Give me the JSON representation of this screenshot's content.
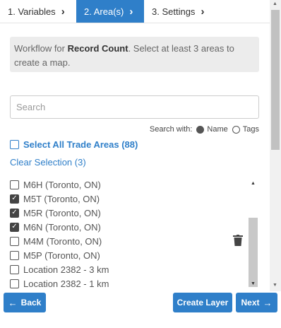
{
  "tabs": [
    {
      "label": "1. Variables"
    },
    {
      "label": "2. Area(s)"
    },
    {
      "label": "3. Settings"
    }
  ],
  "info": {
    "prefix": "Workflow for ",
    "bold": "Record Count",
    "suffix": ". Select at least 3 areas to create a map."
  },
  "search": {
    "placeholder": "Search",
    "search_with_label": "Search with:",
    "options": [
      {
        "label": "Name",
        "selected": true
      },
      {
        "label": "Tags",
        "selected": false
      }
    ]
  },
  "select_all_label": "Select All Trade Areas (88)",
  "clear_selection_label": "Clear Selection (3)",
  "areas": [
    {
      "label": "M6H (Toronto, ON)",
      "checked": false
    },
    {
      "label": "M5T (Toronto, ON)",
      "checked": true
    },
    {
      "label": "M5R (Toronto, ON)",
      "checked": true
    },
    {
      "label": "M6N (Toronto, ON)",
      "checked": true
    },
    {
      "label": "M4M (Toronto, ON)",
      "checked": false
    },
    {
      "label": "M5P (Toronto, ON)",
      "checked": false
    },
    {
      "label": "Location 2382 - 3 km",
      "checked": false
    },
    {
      "label": "Location 2382 - 1 km",
      "checked": false
    }
  ],
  "buttons": {
    "back": "Back",
    "create_layer": "Create Layer",
    "next": "Next"
  },
  "icons": {
    "chevron": "chevron-right-icon",
    "delete": "trash-icon",
    "back": "arrow-left-icon",
    "next": "arrow-right-icon"
  },
  "colors": {
    "accent": "#2f7fc9",
    "info_bg": "#ececec"
  }
}
